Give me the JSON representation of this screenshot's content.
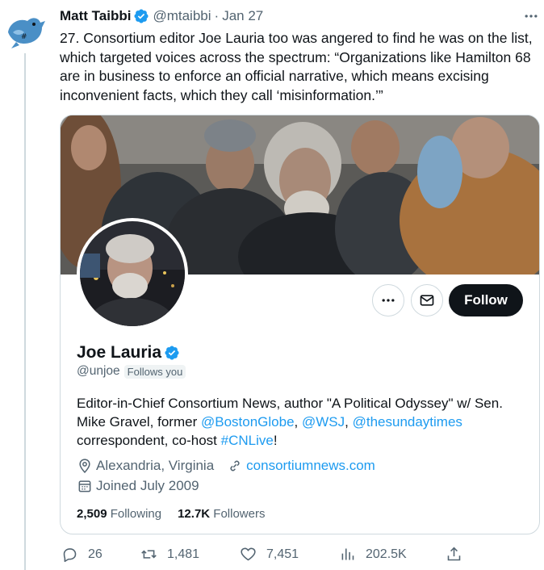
{
  "tweet": {
    "author_name": "Matt Taibbi",
    "author_handle": "@mtaibbi",
    "separator": "·",
    "date": "Jan 27",
    "text": "27. Consortium editor Joe Lauria too was angered to find he was on the list, which targeted voices across the spectrum: “Organizations like Hamilton 68 are in business to enforce an official narrative, which means excising inconvenient facts, which they call ‘misinformation.’”"
  },
  "card": {
    "follow_label": "Follow",
    "name": "Joe Lauria",
    "handle": "@unjoe",
    "follows_you": "Follows you",
    "bio": {
      "part1": "Editor-in-Chief Consortium News, author \"A Political  Odyssey\" w/ Sen. Mike Gravel, former ",
      "mention1": "@BostonGlobe",
      "comma1": ", ",
      "mention2": "@WSJ",
      "comma2": ", ",
      "mention3": "@thesundaytimes",
      "part2": " correspondent, co-host ",
      "hashtag": "#CNLive",
      "part3": "!"
    },
    "location": "Alexandria, Virginia",
    "website": "consortiumnews.com",
    "joined": "Joined July 2009",
    "following_count": "2,509",
    "following_label": "Following",
    "followers_count": "12.7K",
    "followers_label": "Followers"
  },
  "actions": {
    "replies": "26",
    "retweets": "1,481",
    "likes": "7,451",
    "views": "202.5K"
  },
  "icons": {
    "verified": "verified-badge-icon",
    "more": "more-dots-icon",
    "message": "envelope-icon",
    "location": "location-pin-icon",
    "link": "link-icon",
    "calendar": "calendar-icon",
    "reply": "reply-icon",
    "retweet": "retweet-icon",
    "like": "heart-icon",
    "views": "views-bar-icon",
    "share": "share-icon"
  },
  "colors": {
    "accent": "#1d9bf0",
    "text": "#0f1419",
    "muted": "#536471",
    "border": "#cfd9de",
    "follow_bg": "#0f1419"
  }
}
